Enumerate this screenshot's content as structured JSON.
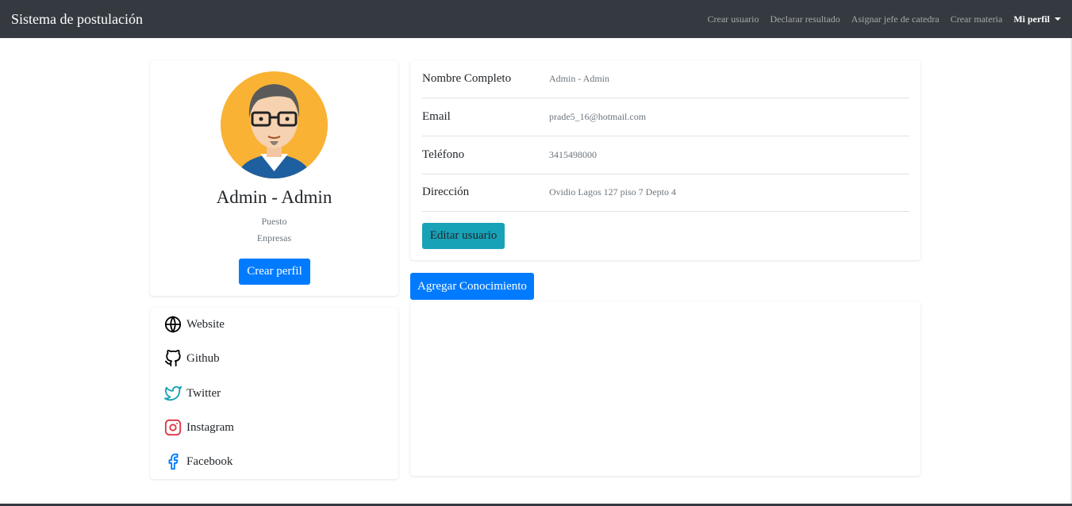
{
  "navbar": {
    "brand": "Sistema de postulación",
    "links": [
      "Crear usuario",
      "Declarar resultado",
      "Asignar jefe de catedra",
      "Crear materia"
    ],
    "profile_menu": "Mi perfil"
  },
  "profile": {
    "name": "Admin - Admin",
    "position": "Puesto",
    "companies": "Enpresas",
    "create_profile_label": "Crear perfil"
  },
  "social_links": [
    {
      "label": "Website",
      "icon": "globe-icon"
    },
    {
      "label": "Github",
      "icon": "github-icon"
    },
    {
      "label": "Twitter",
      "icon": "twitter-icon"
    },
    {
      "label": "Instagram",
      "icon": "instagram-icon"
    },
    {
      "label": "Facebook",
      "icon": "facebook-icon"
    }
  ],
  "user_info": {
    "rows": [
      {
        "label": "Nombre Completo",
        "value": "Admin - Admin"
      },
      {
        "label": "Email",
        "value": "prade5_16@hotmail.com"
      },
      {
        "label": "Teléfono",
        "value": "3415498000"
      },
      {
        "label": "Dirección",
        "value": "Ovidio Lagos 127 piso 7 Depto 4"
      }
    ],
    "edit_label": "Editar usuario"
  },
  "knowledge": {
    "add_label": "Agregar Conocimiento"
  },
  "colors": {
    "navbar": "#343a40",
    "primary": "#007bff",
    "info": "#17a2b8",
    "twitter": "#17a2b8",
    "instagram": "#dc3545"
  }
}
